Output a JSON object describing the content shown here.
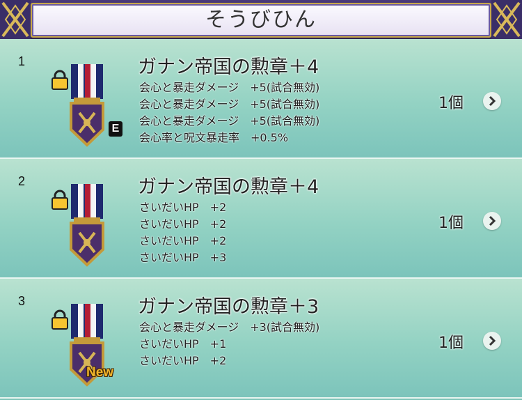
{
  "header": {
    "title": "そうびひん"
  },
  "items": [
    {
      "index": "1",
      "name": "ガナン帝国の勲章＋4",
      "stats": [
        "会心と暴走ダメージ　+5(試合無効)",
        "会心と暴走ダメージ　+5(試合無効)",
        "会心と暴走ダメージ　+5(試合無効)",
        "会心率と呪文暴走率　+0.5%"
      ],
      "count": "1個",
      "badge": "E",
      "locked": true
    },
    {
      "index": "2",
      "name": "ガナン帝国の勲章＋4",
      "stats": [
        "さいだいHP　+2",
        "さいだいHP　+2",
        "さいだいHP　+2",
        "さいだいHP　+3"
      ],
      "count": "1個",
      "badge": "",
      "locked": true
    },
    {
      "index": "3",
      "name": "ガナン帝国の勲章＋3",
      "stats": [
        "会心と暴走ダメージ　+3(試合無効)",
        "さいだいHP　+1",
        "さいだいHP　+2"
      ],
      "count": "1個",
      "badge": "New",
      "locked": true
    }
  ],
  "icons": {
    "lock": "lock-icon",
    "medal": "medal-icon",
    "chevron": "chevron-right-icon"
  },
  "colors": {
    "header_bg": "#2e2452",
    "header_panel": "#f4f1fa",
    "row_bg": "#93d2c3",
    "new_badge": "#f3b52a"
  }
}
